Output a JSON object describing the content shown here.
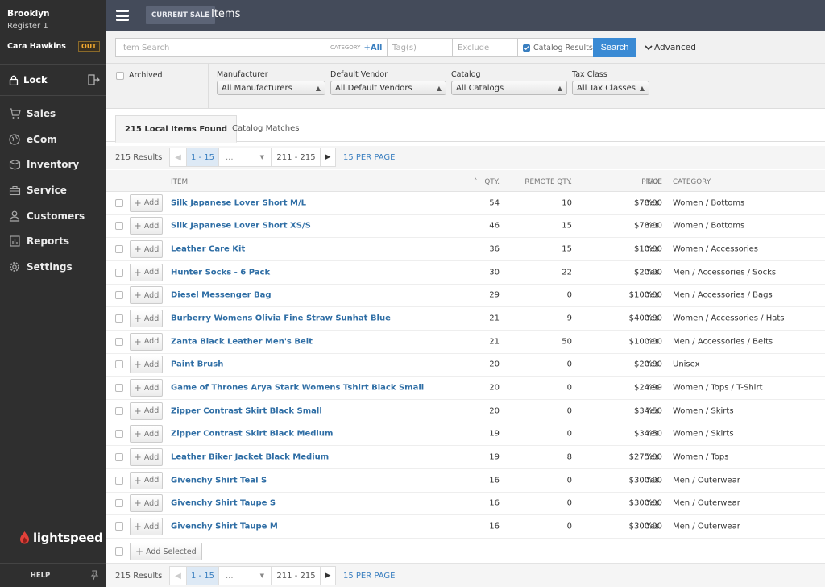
{
  "sidebar": {
    "store": "Brooklyn",
    "register": "Register 1",
    "user": "Cara Hawkins",
    "status_badge": "OUT",
    "lock_label": "Lock",
    "nav": [
      {
        "label": "Sales",
        "icon": "cart-icon"
      },
      {
        "label": "eCom",
        "icon": "globe-icon"
      },
      {
        "label": "Inventory",
        "icon": "box-icon"
      },
      {
        "label": "Service",
        "icon": "toolbox-icon"
      },
      {
        "label": "Customers",
        "icon": "person-icon"
      },
      {
        "label": "Reports",
        "icon": "chart-icon"
      },
      {
        "label": "Settings",
        "icon": "gear-icon"
      }
    ],
    "logo_text": "lightspeed",
    "help_label": "HELP"
  },
  "topbar": {
    "current_sale_label": "CURRENT SALE",
    "title": "Items"
  },
  "search": {
    "item_placeholder": "Item Search",
    "category_label": "CATEGORY",
    "category_value": "+All",
    "tags_placeholder": "Tag(s)",
    "exclude_placeholder": "Exclude",
    "catalog_results_label": "Catalog Results",
    "catalog_results_checked": true,
    "search_button": "Search",
    "advanced_label": "Advanced"
  },
  "filters": {
    "archived_label": "Archived",
    "manufacturer": {
      "label": "Manufacturer",
      "value": "All Manufacturers"
    },
    "vendor": {
      "label": "Default Vendor",
      "value": "All Default Vendors"
    },
    "catalog": {
      "label": "Catalog",
      "value": "All Catalogs"
    },
    "tax_class": {
      "label": "Tax Class",
      "value": "All Tax Classes"
    }
  },
  "tabs": {
    "local": "215 Local Items Found",
    "catalog": "Catalog Matches"
  },
  "pager": {
    "results": "215 Results",
    "current": "1 - 15",
    "ellipsis": "...",
    "last": "211 - 215",
    "per_page": "15 PER PAGE"
  },
  "table": {
    "headers": {
      "item": "ITEM",
      "qty": "QTY.",
      "remote_qty": "REMOTE QTY.",
      "price": "PRICE",
      "tax": "TAX",
      "category": "CATEGORY"
    },
    "add_label": "Add",
    "rows": [
      {
        "name": "Silk Japanese Lover Short M/L",
        "qty": "54",
        "remote_qty": "10",
        "price": "$78.00",
        "tax": "Yes",
        "category": "Women / Bottoms"
      },
      {
        "name": "Silk Japanese Lover Short XS/S",
        "qty": "46",
        "remote_qty": "15",
        "price": "$78.00",
        "tax": "Yes",
        "category": "Women / Bottoms"
      },
      {
        "name": "Leather Care Kit",
        "qty": "36",
        "remote_qty": "15",
        "price": "$10.00",
        "tax": "Yes",
        "category": "Women / Accessories"
      },
      {
        "name": "Hunter Socks - 6 Pack",
        "qty": "30",
        "remote_qty": "22",
        "price": "$20.00",
        "tax": "Yes",
        "category": "Men / Accessories / Socks"
      },
      {
        "name": "Diesel Messenger Bag",
        "qty": "29",
        "remote_qty": "0",
        "price": "$100.00",
        "tax": "Yes",
        "category": "Men / Accessories / Bags"
      },
      {
        "name": "Burberry Womens Olivia Fine Straw Sunhat Blue",
        "qty": "21",
        "remote_qty": "9",
        "price": "$400.00",
        "tax": "Yes",
        "category": "Women / Accessories / Hats"
      },
      {
        "name": "Zanta Black Leather Men's Belt",
        "qty": "21",
        "remote_qty": "50",
        "price": "$100.00",
        "tax": "Yes",
        "category": "Men / Accessories / Belts"
      },
      {
        "name": "Paint Brush",
        "qty": "20",
        "remote_qty": "0",
        "price": "$20.00",
        "tax": "Yes",
        "category": "Unisex"
      },
      {
        "name": "Game of Thrones Arya Stark Womens Tshirt Black Small",
        "qty": "20",
        "remote_qty": "0",
        "price": "$24.99",
        "tax": "Yes",
        "category": "Women / Tops / T-Shirt"
      },
      {
        "name": "Zipper Contrast Skirt Black Small",
        "qty": "20",
        "remote_qty": "0",
        "price": "$34.50",
        "tax": "Yes",
        "category": "Women / Skirts"
      },
      {
        "name": "Zipper Contrast Skirt Black Medium",
        "qty": "19",
        "remote_qty": "0",
        "price": "$34.50",
        "tax": "Yes",
        "category": "Women / Skirts"
      },
      {
        "name": "Leather Biker Jacket Black Medium",
        "qty": "19",
        "remote_qty": "8",
        "price": "$275.00",
        "tax": "Yes",
        "category": "Women / Tops"
      },
      {
        "name": "Givenchy Shirt Teal S",
        "qty": "16",
        "remote_qty": "0",
        "price": "$300.00",
        "tax": "Yes",
        "category": "Men / Outerwear"
      },
      {
        "name": "Givenchy Shirt Taupe S",
        "qty": "16",
        "remote_qty": "0",
        "price": "$300.00",
        "tax": "Yes",
        "category": "Men / Outerwear"
      },
      {
        "name": "Givenchy Shirt Taupe M",
        "qty": "16",
        "remote_qty": "0",
        "price": "$300.00",
        "tax": "Yes",
        "category": "Men / Outerwear"
      }
    ],
    "add_selected_label": "Add Selected"
  },
  "colors": {
    "link": "#2f6ea5",
    "accent": "#3a8ad4",
    "sidebar_bg": "#2f2f2f",
    "topbar_bg": "#444b5a",
    "badge": "#f0a830",
    "logo_red": "#e2413a"
  }
}
